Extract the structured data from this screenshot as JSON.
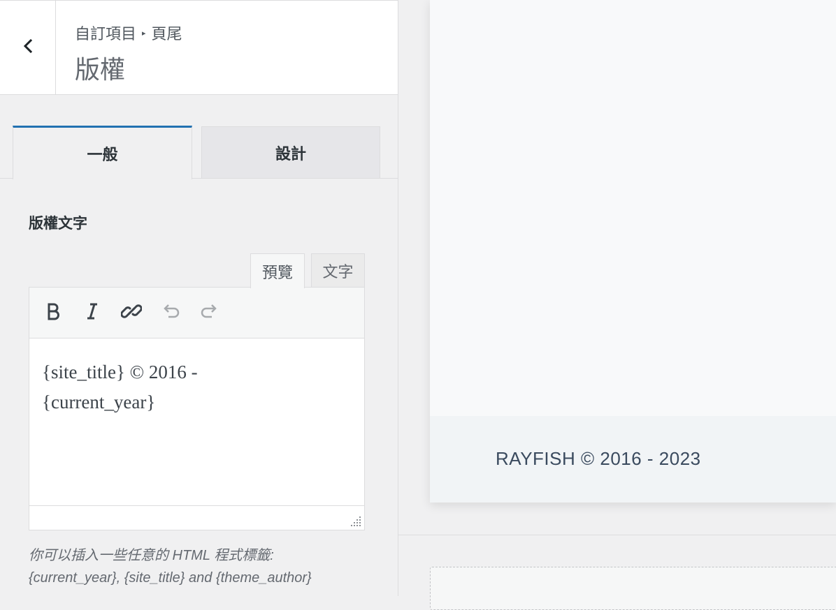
{
  "header": {
    "breadcrumb_root": "自訂項目",
    "breadcrumb_separator": "▸",
    "breadcrumb_section": "頁尾",
    "title": "版權",
    "back_icon": "chevron-left-icon"
  },
  "tabs": {
    "general": "一般",
    "design": "設計"
  },
  "field": {
    "label": "版權文字"
  },
  "editor": {
    "mode_visual": "預覽",
    "mode_text": "文字",
    "toolbar": [
      "bold-icon",
      "italic-icon",
      "link-icon",
      "undo-icon",
      "redo-icon"
    ],
    "content_line1": "{site_title} © 2016 -",
    "content_line2": "{current_year}"
  },
  "description": {
    "line1": "你可以插入一些任意的 HTML 程式標籤:",
    "line2": "{current_year}, {site_title} and {theme_author}"
  },
  "preview": {
    "footer_text": "RAYFISH © 2016 - 2023"
  },
  "colors": {
    "accent": "#2271b1",
    "panel_bg": "#f0f0f1",
    "footer_bg": "#f1f4f6"
  }
}
